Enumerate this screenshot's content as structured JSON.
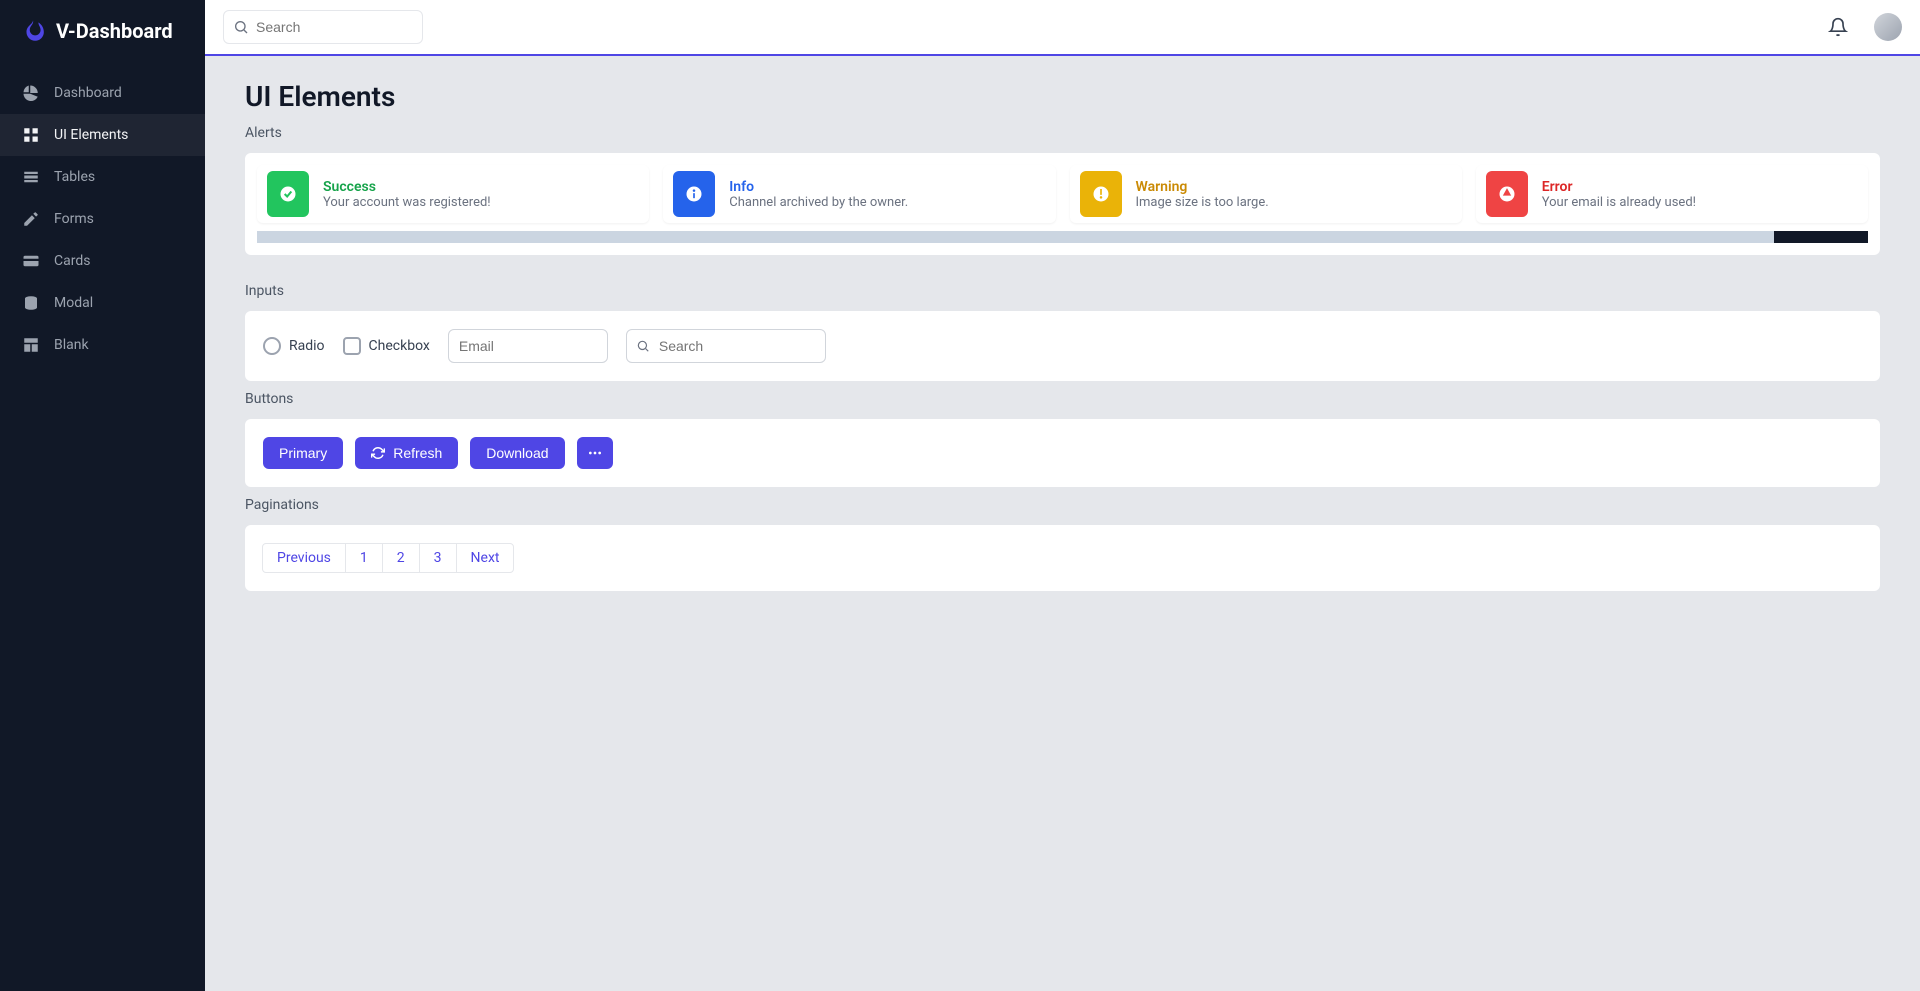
{
  "brand": "V-Dashboard",
  "header": {
    "search_placeholder": "Search"
  },
  "sidebar": {
    "items": [
      {
        "label": "Dashboard"
      },
      {
        "label": "UI Elements"
      },
      {
        "label": "Tables"
      },
      {
        "label": "Forms"
      },
      {
        "label": "Cards"
      },
      {
        "label": "Modal"
      },
      {
        "label": "Blank"
      }
    ]
  },
  "page": {
    "title": "UI Elements"
  },
  "sections": {
    "alerts": {
      "heading": "Alerts",
      "items": [
        {
          "title": "Success",
          "message": "Your account was registered!"
        },
        {
          "title": "Info",
          "message": "Channel archived by the owner."
        },
        {
          "title": "Warning",
          "message": "Image size is too large."
        },
        {
          "title": "Error",
          "message": "Your email is already used!"
        }
      ]
    },
    "inputs": {
      "heading": "Inputs",
      "radio_label": "Radio",
      "checkbox_label": "Checkbox",
      "email_placeholder": "Email",
      "search_placeholder": "Search"
    },
    "buttons": {
      "heading": "Buttons",
      "primary": "Primary",
      "refresh": "Refresh",
      "download": "Download"
    },
    "paginations": {
      "heading": "Paginations",
      "previous": "Previous",
      "p1": "1",
      "p2": "2",
      "p3": "3",
      "next": "Next"
    }
  }
}
